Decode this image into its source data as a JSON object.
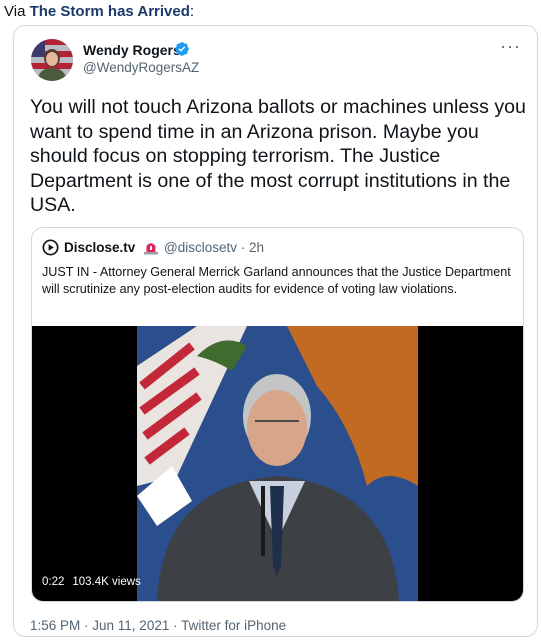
{
  "header": {
    "via_prefix": "Via ",
    "source_name": "The Storm has Arrived",
    "source_suffix": ":"
  },
  "tweet": {
    "author_name": "Wendy Rogers",
    "author_handle": "@WendyRogersAZ",
    "verified_icon": "verified-badge-icon",
    "more_icon": "more-options-icon",
    "text": "You will not touch Arizona ballots or machines unless you want to spend time in an Arizona prison. Maybe you should focus on stopping terrorism. The Justice Department is one of the most corrupt institutions in the USA.",
    "timestamp": "1:56 PM · Jun 11, 2021 · Twitter for iPhone"
  },
  "quoted": {
    "author_name": "Disclose.tv",
    "handle_time": "@disclosetv · 2h",
    "logo_icon": "play-circle-icon",
    "emoji_icon": "siren-icon",
    "text": "JUST IN - Attorney General Merrick Garland announces that the Justice Department will scrutinize any post-election audits for evidence of voting law violations.",
    "video": {
      "duration": "0:22",
      "views": "103.4K views"
    }
  },
  "colors": {
    "border": "#cfd9de",
    "secondary_text": "#536471",
    "verified": "#1d9bf0",
    "source_link": "#1b3a6b"
  }
}
